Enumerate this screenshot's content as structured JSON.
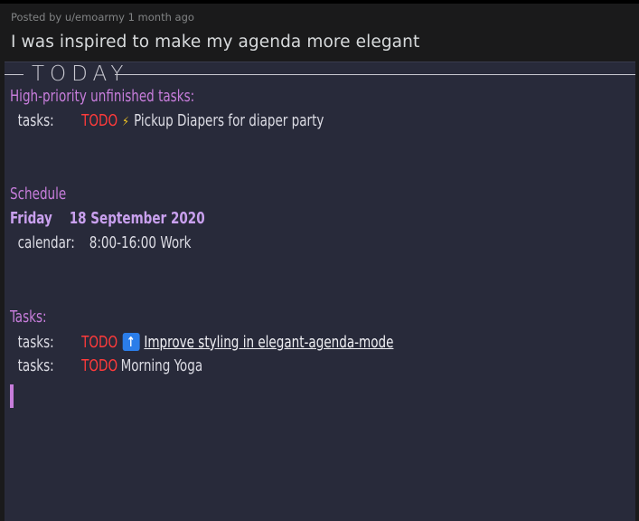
{
  "post": {
    "meta": "Posted by u/emoarmy 1 month ago",
    "title": "I was inspired to make my agenda more elegant"
  },
  "agenda": {
    "today_label": "TODAY",
    "high_priority_heading": "High-priority unfinished tasks:",
    "high_priority_items": [
      {
        "key": "tasks:",
        "state": "TODO",
        "icon": "lightning-icon",
        "text": "Pickup Diapers for diaper party"
      }
    ],
    "schedule_heading": "Schedule",
    "date_day": "Friday",
    "date_full": "18 September 2020",
    "schedule_items": [
      {
        "key": "calendar:",
        "text": "8:00-16:00 Work"
      }
    ],
    "tasks_heading": "Tasks:",
    "task_items": [
      {
        "key": "tasks:",
        "state": "TODO",
        "icon": "up-arrow-icon",
        "text": "Improve styling in elegant-agenda-mode"
      },
      {
        "key": "tasks:",
        "state": "TODO",
        "text": "Morning Yoga"
      }
    ]
  },
  "colors": {
    "background": "#282a3a",
    "heading": "#c77ddb",
    "todo": "#ff3b3b",
    "date": "#c9a0ee"
  }
}
